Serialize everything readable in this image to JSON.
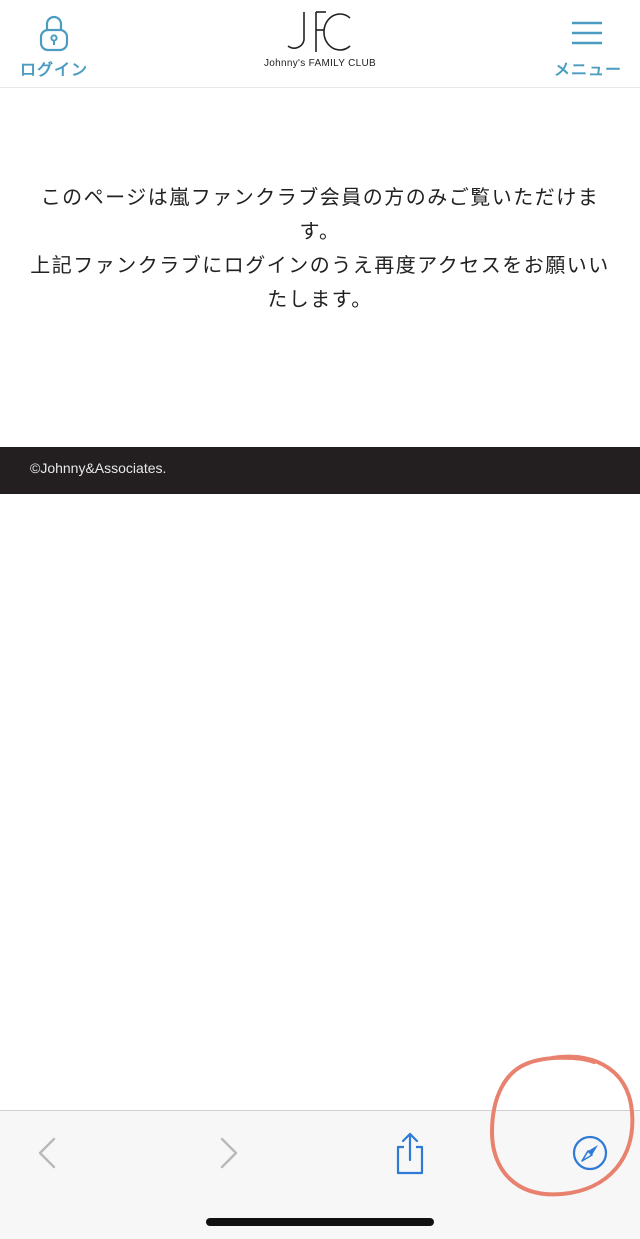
{
  "header": {
    "login_label": "ログイン",
    "logo_caption": "Johnny's FAMILY CLUB",
    "menu_label": "メニュー",
    "accent_color": "#4a9cc0"
  },
  "message": {
    "lines": [
      "このページは嵐ファンクラブ会員の方のみご覧いただけます。",
      "上記ファンクラブにログインのうえ再度アクセスをお願いいたします。"
    ]
  },
  "footer": {
    "copyright": "©Johnny&Associates.",
    "background": "#231f20"
  },
  "toolbar": {
    "icons": [
      "back-chevron-icon",
      "forward-chevron-icon",
      "share-icon",
      "compass-icon"
    ],
    "active_color": "#2f7ad6",
    "disabled_color": "#b9b9b9"
  },
  "annotation": {
    "color": "#e8826e"
  }
}
